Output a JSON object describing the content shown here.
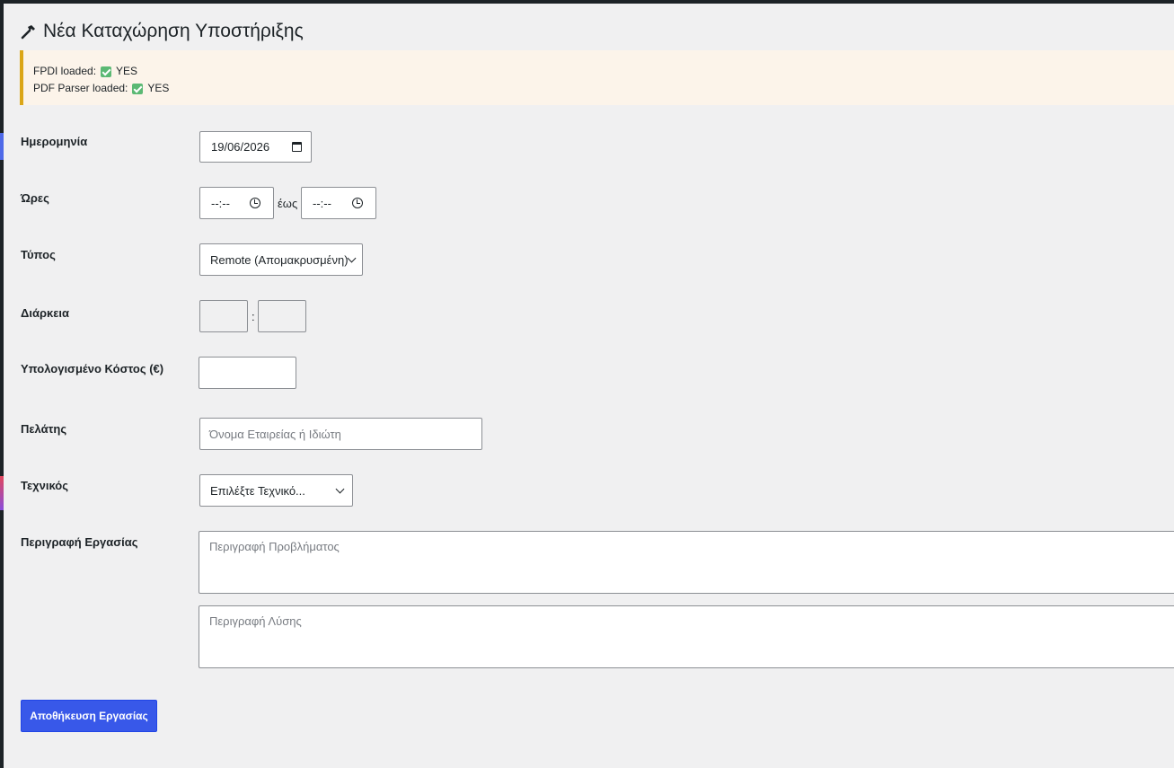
{
  "page": {
    "title": "Νέα Καταχώρηση Υποστήριξης",
    "title_icon": "hammer-icon"
  },
  "notice": {
    "fpdi_label": "FPDI loaded:",
    "fpdi_value": "YES",
    "parser_label": "PDF Parser loaded:",
    "parser_value": "YES",
    "accent_color": "#dba617",
    "check_color": "#5bb974"
  },
  "form": {
    "date_label": "Ημερομηνία",
    "date_value": "19/06/2026",
    "hours_label": "Ώρες",
    "time_from_value": "--:--",
    "time_to_value": "--:--",
    "hours_separator": "έως",
    "type_label": "Τύπος",
    "type_value": "Remote (Απομακρυσμένη)",
    "duration_label": "Διάρκεια",
    "duration_separator": ":",
    "cost_label": "Υπολογισμένο Κόστος (€)",
    "client_label": "Πελάτης",
    "client_placeholder": "Όνομα Εταιρείας ή Ιδιώτη",
    "technician_label": "Τεχνικός",
    "technician_value": "Επιλέξτε Τεχνικό...",
    "description_label": "Περιγραφή Εργασίας",
    "problem_placeholder": "Περιγραφή Προβλήματος",
    "solution_placeholder": "Περιγραφή Λύσης",
    "save_label": "Αποθήκευση Εργασίας",
    "primary_color": "#3858e9"
  }
}
